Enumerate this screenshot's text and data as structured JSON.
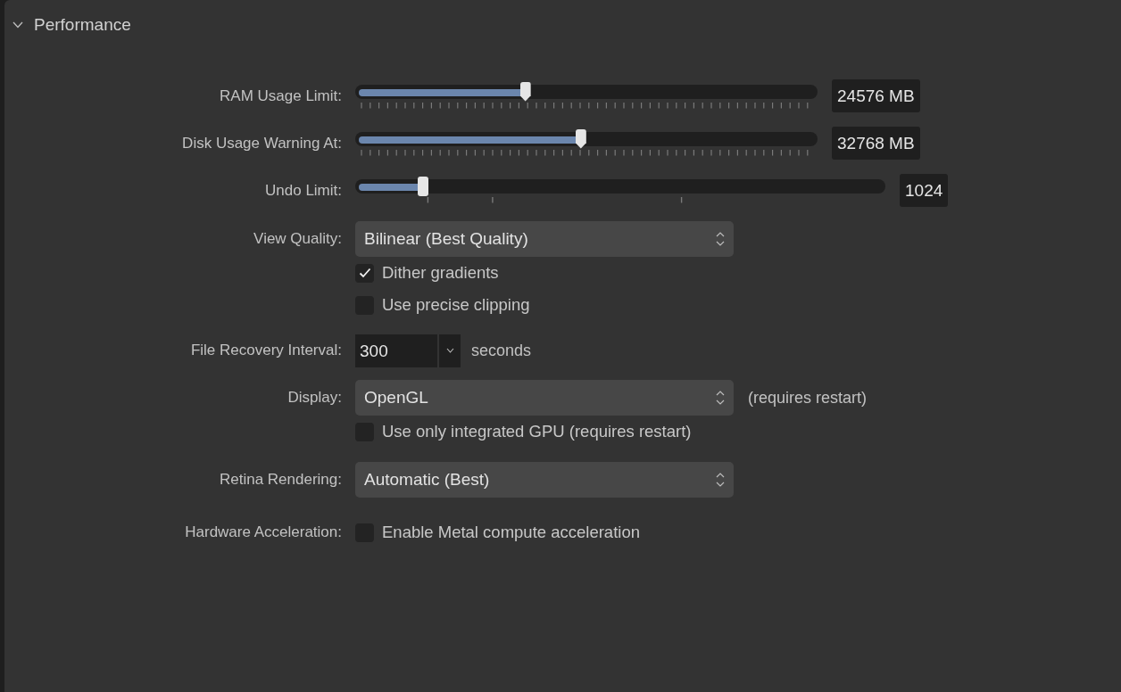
{
  "section": {
    "title": "Performance",
    "expanded": true
  },
  "rows": [
    {
      "kind": "fine_slider",
      "label": "RAM Usage Limit:",
      "level": 0.37,
      "value": "24576 MB"
    },
    {
      "kind": "fine_slider",
      "label": "Disk Usage Warning At:",
      "level": 0.49,
      "value": "32768 MB"
    },
    {
      "kind": "coarse_slider",
      "label": "Undo Limit:",
      "level": 0.13,
      "value": "1024"
    },
    {
      "kind": "select",
      "label": "View Quality:",
      "value": "Bilinear (Best Quality)"
    },
    {
      "kind": "checkbox",
      "text": "Dither gradients",
      "checked": true
    },
    {
      "kind": "checkbox",
      "text": "Use precise clipping",
      "checked": false
    },
    {
      "kind": "combo",
      "label": "File Recovery Interval:",
      "value": "300",
      "suffix": "seconds"
    },
    {
      "kind": "select",
      "label": "Display:",
      "value": "OpenGL",
      "note": "(requires restart)"
    },
    {
      "kind": "checkbox",
      "text": "Use only integrated GPU (requires restart)",
      "checked": false
    },
    {
      "kind": "select",
      "label": "Retina Rendering:",
      "value": "Automatic (Best)"
    },
    {
      "kind": "checkbox",
      "label": "Hardware Acceleration:",
      "text": "Enable Metal compute acceleration",
      "checked": false
    }
  ]
}
